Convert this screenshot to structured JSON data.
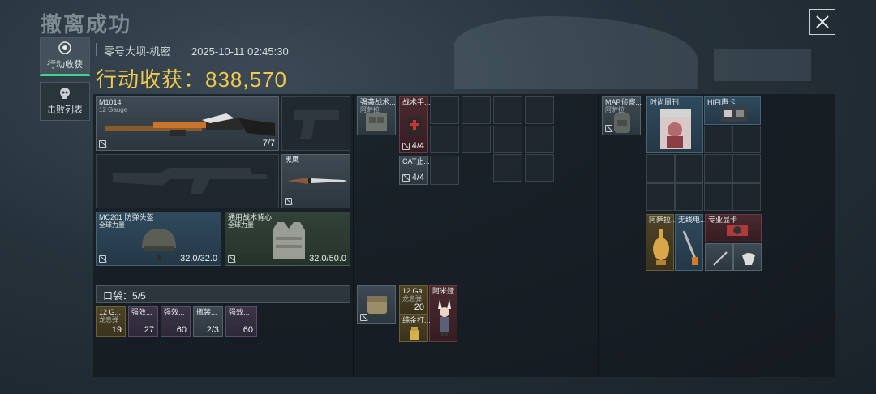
{
  "header": {
    "title": "撤离成功",
    "map_name": "零号大坝-机密",
    "datetime": "2025-10-11 02:45:30",
    "haul_label": "行动收获：",
    "haul_value": "838,570"
  },
  "sidebar": {
    "items": [
      {
        "label": "行动收获",
        "active": true,
        "icon": "loot-icon"
      },
      {
        "label": "击败列表",
        "active": false,
        "icon": "skull-icon"
      }
    ]
  },
  "loadout": {
    "primary_weapon": {
      "name": "M1014",
      "sub": "12 Gauge",
      "count": "7/7"
    },
    "knife": {
      "name": "黑鹰"
    },
    "helmet": {
      "name": "MC201 防弹头盔",
      "sub": "全球力量",
      "durability": "32.0/32.0"
    },
    "vest": {
      "name": "通用战术背心",
      "sub": "全球力量",
      "durability": "32.0/50.0"
    },
    "pocket_label": "口袋：5/5",
    "pockets": [
      {
        "name": "12 G...",
        "sub": "龙息弹",
        "count": "19"
      },
      {
        "name": "强效...",
        "count": "27"
      },
      {
        "name": "强效...",
        "count": "60"
      },
      {
        "name": "瓶装...",
        "count": "2/3"
      },
      {
        "name": "强效...",
        "count": "60"
      }
    ]
  },
  "rig": {
    "items": [
      {
        "name": "强袭战术...",
        "sub": "阿萨拉"
      },
      {
        "name": "战术手...",
        "count": "4/4"
      },
      {
        "name": "CAT止...",
        "count": "4/4"
      }
    ],
    "bag_items": [
      {
        "name": "12 Ga...",
        "sub": "龙息弹",
        "count": "20"
      },
      {
        "name": "阿米娅..."
      },
      {
        "name": "纯金打..."
      }
    ]
  },
  "backpack": {
    "items": [
      {
        "name": "MAP侦察...",
        "sub": "阿萨拉"
      },
      {
        "name": "时尚周刊"
      },
      {
        "name": "HIFI声卡"
      },
      {
        "name": "阿萨拉..."
      },
      {
        "name": "无线电..."
      },
      {
        "name": "专业显卡"
      }
    ]
  },
  "colors": {
    "accent_gold": "#f2c94c",
    "active_green": "#3fd38b"
  }
}
